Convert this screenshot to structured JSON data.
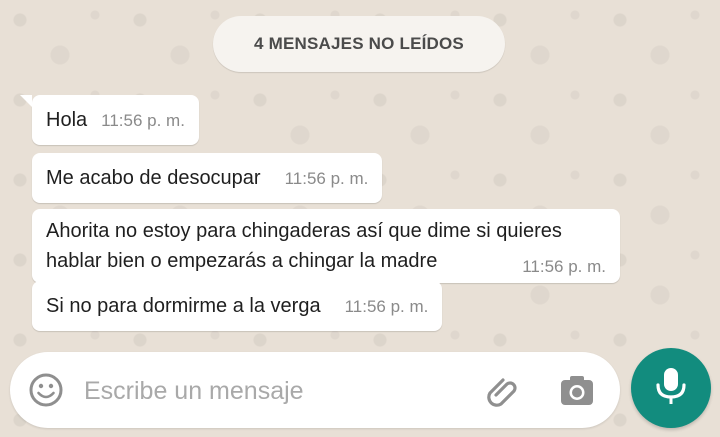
{
  "unread_banner": {
    "label": "4 MENSAJES NO LEÍDOS"
  },
  "messages": [
    {
      "text": "Hola",
      "time": "11:56 p. m."
    },
    {
      "text": "Me acabo de desocupar",
      "time": "11:56 p. m."
    },
    {
      "text": "Ahorita no estoy para chingaderas así que dime si quieres hablar bien o empezarás a chingar la madre",
      "time": "11:56 p. m."
    },
    {
      "text": "Si no para dormirme a la verga",
      "time": "11:56 p. m."
    }
  ],
  "composer": {
    "placeholder": "Escribe un mensaje",
    "value": ""
  },
  "icons": {
    "emoji": "emoji-icon",
    "attach": "paperclip-icon",
    "camera": "camera-icon",
    "mic": "microphone-icon"
  },
  "colors": {
    "accent": "#128c7e",
    "bubble": "#ffffff",
    "background": "#e8e0d6",
    "timestamp": "#8a8a8a"
  }
}
